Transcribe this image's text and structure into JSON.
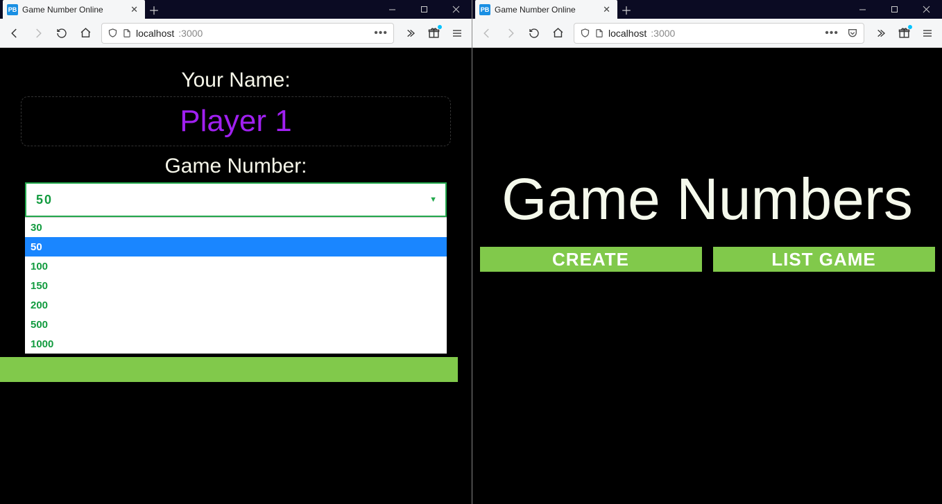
{
  "windows": {
    "left": {
      "tab_title": "Game Number Online",
      "favicon_text": "PB",
      "url_host": "localhost",
      "url_port": ":3000",
      "form": {
        "name_label": "Your Name:",
        "name_value": "Player 1",
        "number_label": "Game Number:",
        "selected": "50",
        "options": [
          "30",
          "50",
          "100",
          "150",
          "200",
          "500",
          "1000"
        ],
        "highlighted_index": 1
      }
    },
    "right": {
      "tab_title": "Game Number Online",
      "favicon_text": "PB",
      "url_host": "localhost",
      "url_port": ":3000",
      "page": {
        "title": "Game Numbers",
        "create_label": "CREATE",
        "list_label": "LIST GAME"
      }
    }
  }
}
